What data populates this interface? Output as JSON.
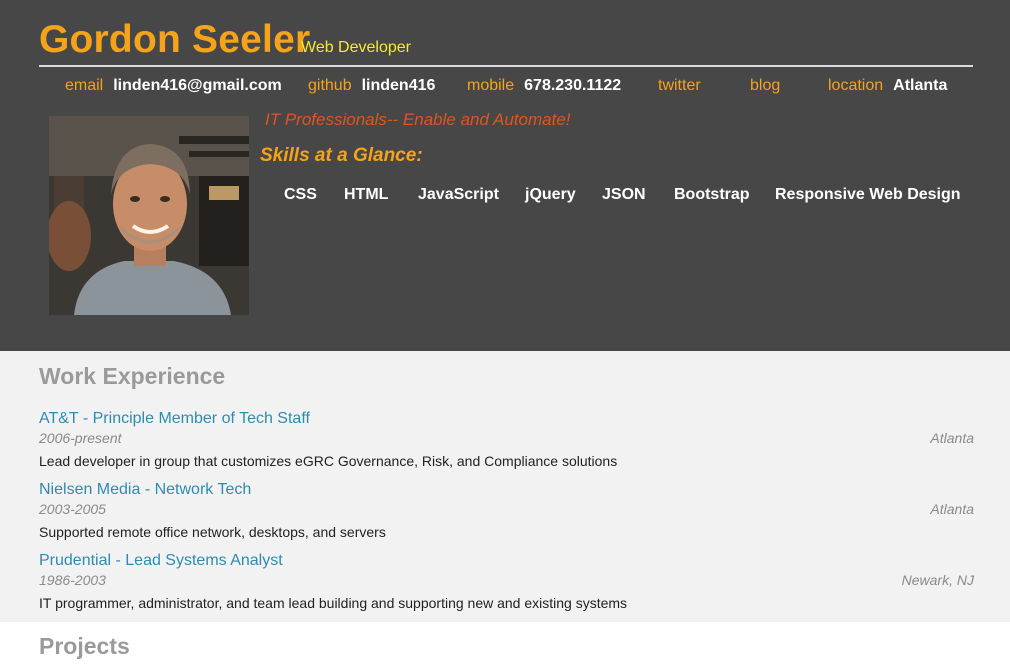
{
  "header": {
    "name": "Gordon Seeler",
    "role": "Web Developer",
    "contacts": [
      {
        "label": "email",
        "value": "linden416@gmail.com"
      },
      {
        "label": "github",
        "value": "linden416"
      },
      {
        "label": "mobile",
        "value": "678.230.1122"
      },
      {
        "label": "twitter",
        "value": ""
      },
      {
        "label": "blog",
        "value": ""
      },
      {
        "label": "location",
        "value": "Atlanta"
      }
    ],
    "tagline": "IT Professionals-- Enable and Automate!",
    "skills_title": "Skills at a Glance:",
    "skills": [
      "CSS",
      "HTML",
      "JavaScript",
      "jQuery",
      "JSON",
      "Bootstrap",
      "Responsive Web Design"
    ]
  },
  "work": {
    "title": "Work Experience",
    "jobs": [
      {
        "title": "AT&T - Principle Member of Tech Staff",
        "dates": "2006-present",
        "location": "Atlanta",
        "description": "Lead developer in group that customizes eGRC Governance, Risk, and Compliance solutions"
      },
      {
        "title": "Nielsen Media - Network Tech",
        "dates": "2003-2005",
        "location": "Atlanta",
        "description": "Supported remote office network, desktops, and servers"
      },
      {
        "title": "Prudential - Lead Systems Analyst",
        "dates": "1986-2003",
        "location": "Newark, NJ",
        "description": "IT programmer, administrator, and team lead building and supporting new and existing systems"
      }
    ]
  },
  "projects": {
    "title": "Projects"
  },
  "colors": {
    "header_bg": "#474747",
    "accent_orange": "#f5a31a",
    "accent_yellow": "#f6ea2a",
    "tagline_red": "#e2541c",
    "link_blue": "#2e8cb0",
    "work_bg": "#f2f2f2"
  }
}
